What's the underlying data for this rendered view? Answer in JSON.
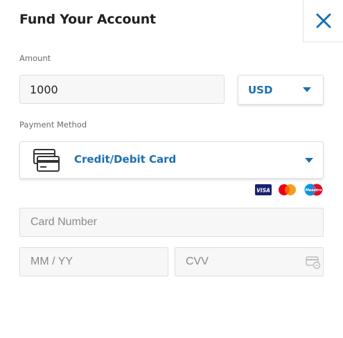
{
  "header": {
    "title": "Fund Your Account",
    "close_icon": "close-icon"
  },
  "amount": {
    "label": "Amount",
    "value": "1000",
    "currency": "USD"
  },
  "payment_method": {
    "label": "Payment Method",
    "selected": "Credit/Debit Card",
    "icon": "card-icon",
    "brands": [
      {
        "name": "VISA",
        "icon": "visa-logo"
      },
      {
        "name": "Mastercard",
        "icon": "mastercard-logo"
      },
      {
        "name": "Maestro",
        "icon": "maestro-logo"
      }
    ]
  },
  "card_form": {
    "card_number_placeholder": "Card Number",
    "expiry_placeholder": "MM / YY",
    "cvv_placeholder": "CVV",
    "cvv_icon": "cvv-card-icon"
  },
  "colors": {
    "accent": "#1b6fb0",
    "field_bg": "#f7f7f7",
    "border": "#dedede"
  }
}
